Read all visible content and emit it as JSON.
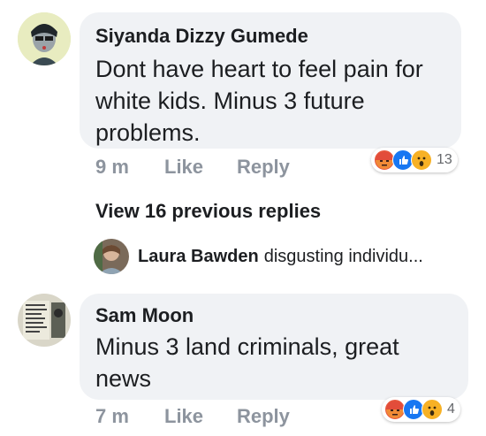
{
  "comments": [
    {
      "author": "Siyanda Dizzy Gumede",
      "text": "Dont have heart to feel pain for white kids. Minus 3 future problems.",
      "time": "9 m",
      "like_label": "Like",
      "reply_label": "Reply",
      "reaction_count": "13"
    },
    {
      "author": "Sam Moon",
      "text": "Minus 3 land criminals, great news",
      "time": "7 m",
      "like_label": "Like",
      "reply_label": "Reply",
      "reaction_count": "4"
    }
  ],
  "thread": {
    "view_previous_label": "View 16 previous replies",
    "latest_reply_author": "Laura Bawden",
    "latest_reply_snippet": "disgusting individu..."
  },
  "reaction_icons": [
    "angry-icon",
    "like-icon",
    "wow-icon"
  ],
  "colors": {
    "bubble": "#f0f2f5",
    "meta_text": "#8d949e",
    "like_blue": "#1877f2",
    "angry_red": "#e9573f",
    "wow_yellow": "#f7b125"
  }
}
